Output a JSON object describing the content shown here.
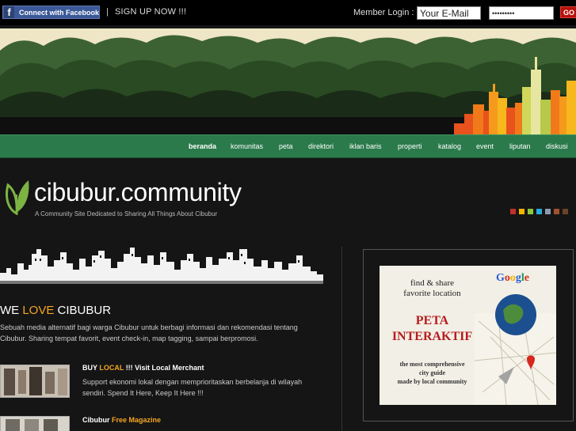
{
  "topbar": {
    "facebook_label": "Connect with Facebook",
    "facebook_glyph": "f",
    "separator": "|",
    "signup_label": "SIGN UP NOW !!!",
    "member_login_label": "Member Login :",
    "email_value": "Your E-Mail",
    "password_value": "•••••••••",
    "go_label": "GO"
  },
  "nav": {
    "items": [
      {
        "label": "beranda"
      },
      {
        "label": "komunitas"
      },
      {
        "label": "peta"
      },
      {
        "label": "direktori"
      },
      {
        "label": "iklan baris"
      },
      {
        "label": "properti"
      },
      {
        "label": "katalog"
      },
      {
        "label": "event"
      },
      {
        "label": "liputan"
      },
      {
        "label": "diskusi"
      }
    ]
  },
  "logo": {
    "title": "cibubur.community",
    "tagline": "A Community Site Dedicated to Sharing All Things About Cibubur"
  },
  "theme_swatches": [
    "#c0302a",
    "#f5b400",
    "#8dc63f",
    "#27a9e1",
    "#8a9bb0",
    "#a0522d",
    "#6b4226"
  ],
  "main": {
    "heading_prefix": "WE ",
    "heading_accent": "LOVE",
    "heading_suffix": " CIBUBUR",
    "intro": "Sebuah media alternatif bagi warga Cibubur untuk berbagi informasi dan rekomendasi tentang Cibubur. Sharing tempat favorit, event check-in, map tagging, sampai berpromosi.",
    "items": [
      {
        "title_prefix": "BUY ",
        "title_accent": "LOCAL",
        "title_suffix": " !!! Visit Local Merchant",
        "desc": "Support ekonomi lokal dengan memprioritaskan berbelanja di wilayah sendiri. Spend It Here, Keep It Here !!!"
      },
      {
        "title_prefix": "Cibubur ",
        "title_accent": "Free Magazine",
        "title_suffix": "",
        "desc": ""
      }
    ]
  },
  "ad": {
    "line1": "find & share",
    "line2": "favorite location",
    "peta": "PETA",
    "interaktif": "INTERAKTIF",
    "small1": "the most comprehensive",
    "small2": "city guide",
    "small3": "made by local community",
    "google_letters": [
      "G",
      "o",
      "o",
      "g",
      "l",
      "e"
    ],
    "google_colors": [
      "#2a5bd7",
      "#d62d20",
      "#f2b400",
      "#2a5bd7",
      "#179c52",
      "#d62d20"
    ]
  },
  "colors": {
    "accent": "#f5a623",
    "nav_bg": "#2b7a4b",
    "facebook": "#3b5998",
    "go_button": "#b8100b"
  }
}
